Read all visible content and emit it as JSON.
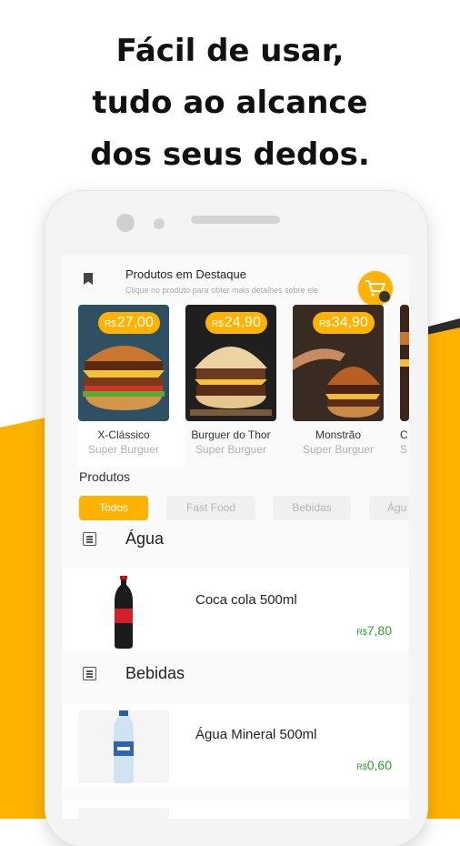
{
  "headline": {
    "line1": "Fácil de usar,",
    "line2": "tudo ao alcance",
    "line3": "dos seus dedos."
  },
  "featured": {
    "title": "Produtos em Destaque",
    "subtitle": "Clique no produto para obter mais detalhes sobre ele",
    "cart_icon": "cart-icon",
    "items": [
      {
        "currency": "R$",
        "price": "27,00",
        "name": "X-Clássico",
        "store": "Super Burguer"
      },
      {
        "currency": "R$",
        "price": "24,90",
        "name": "Burguer do Thor",
        "store": "Super Burguer"
      },
      {
        "currency": "R$",
        "price": "34,90",
        "name": "Monstrão",
        "store": "Super Burguer"
      },
      {
        "currency": "",
        "price": "",
        "name": "C",
        "store": "S"
      }
    ]
  },
  "products": {
    "title": "Produtos",
    "chips": [
      "Todos",
      "Fast Food",
      "Bebidas",
      "Águ"
    ],
    "active_chip": "Todos",
    "categories": [
      {
        "title": "Água",
        "items": [
          {
            "name": "Coca cola 500ml",
            "currency": "R$",
            "price": "7,80"
          }
        ]
      },
      {
        "title": "Bebidas",
        "items": [
          {
            "name": "Água Mineral 500ml",
            "currency": "R$",
            "price": "0,60"
          }
        ]
      }
    ]
  },
  "colors": {
    "accent": "#FFB300",
    "dark_band": "#2b2b2b",
    "price_green": "#2e9e2e"
  }
}
